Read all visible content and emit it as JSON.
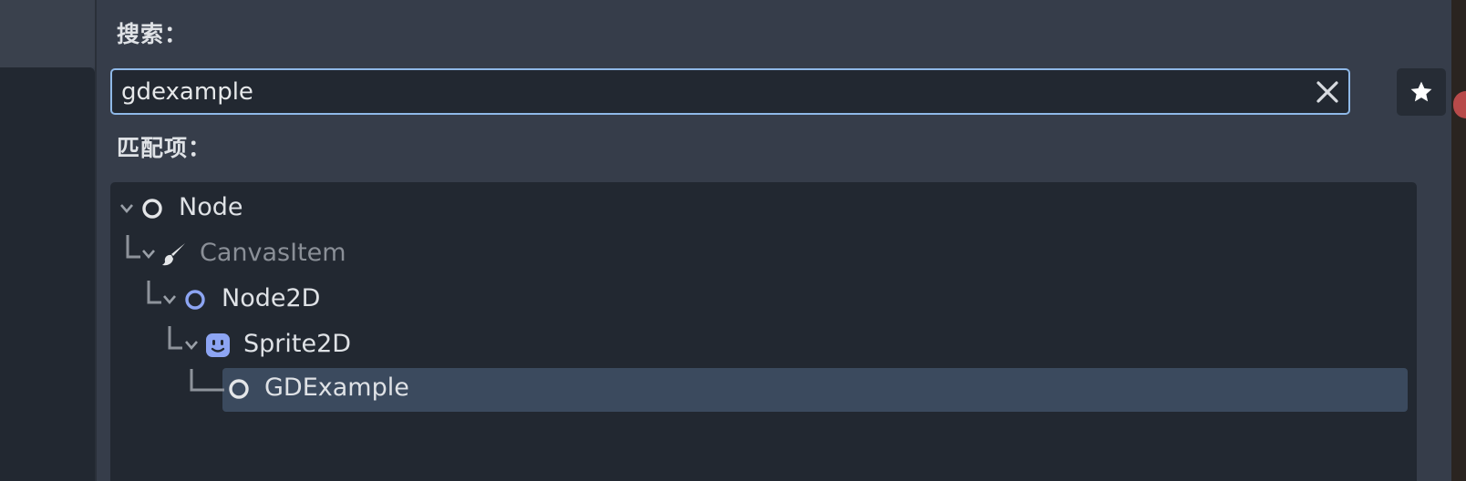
{
  "dialog": {
    "search_label": "搜索：",
    "search_value": "gdexample",
    "matches_label": "匹配项："
  },
  "tree": {
    "items": [
      {
        "label": "Node",
        "icon": "circle-outline-icon",
        "depth": 0,
        "expanded": true
      },
      {
        "label": "CanvasItem",
        "icon": "brush-icon",
        "depth": 1,
        "expanded": true,
        "dimmed": true
      },
      {
        "label": "Node2D",
        "icon": "circle-outline-blue-icon",
        "depth": 2,
        "expanded": true
      },
      {
        "label": "Sprite2D",
        "icon": "sprite-face-icon",
        "depth": 3,
        "expanded": true
      },
      {
        "label": "GDExample",
        "icon": "circle-outline-icon",
        "depth": 4,
        "selected": true
      }
    ]
  },
  "colors": {
    "focus_border": "#8fb9e8",
    "node2d_icon": "#8da5f3",
    "sprite_icon": "#8da5f3",
    "selected_row": "#3b4a5e"
  }
}
